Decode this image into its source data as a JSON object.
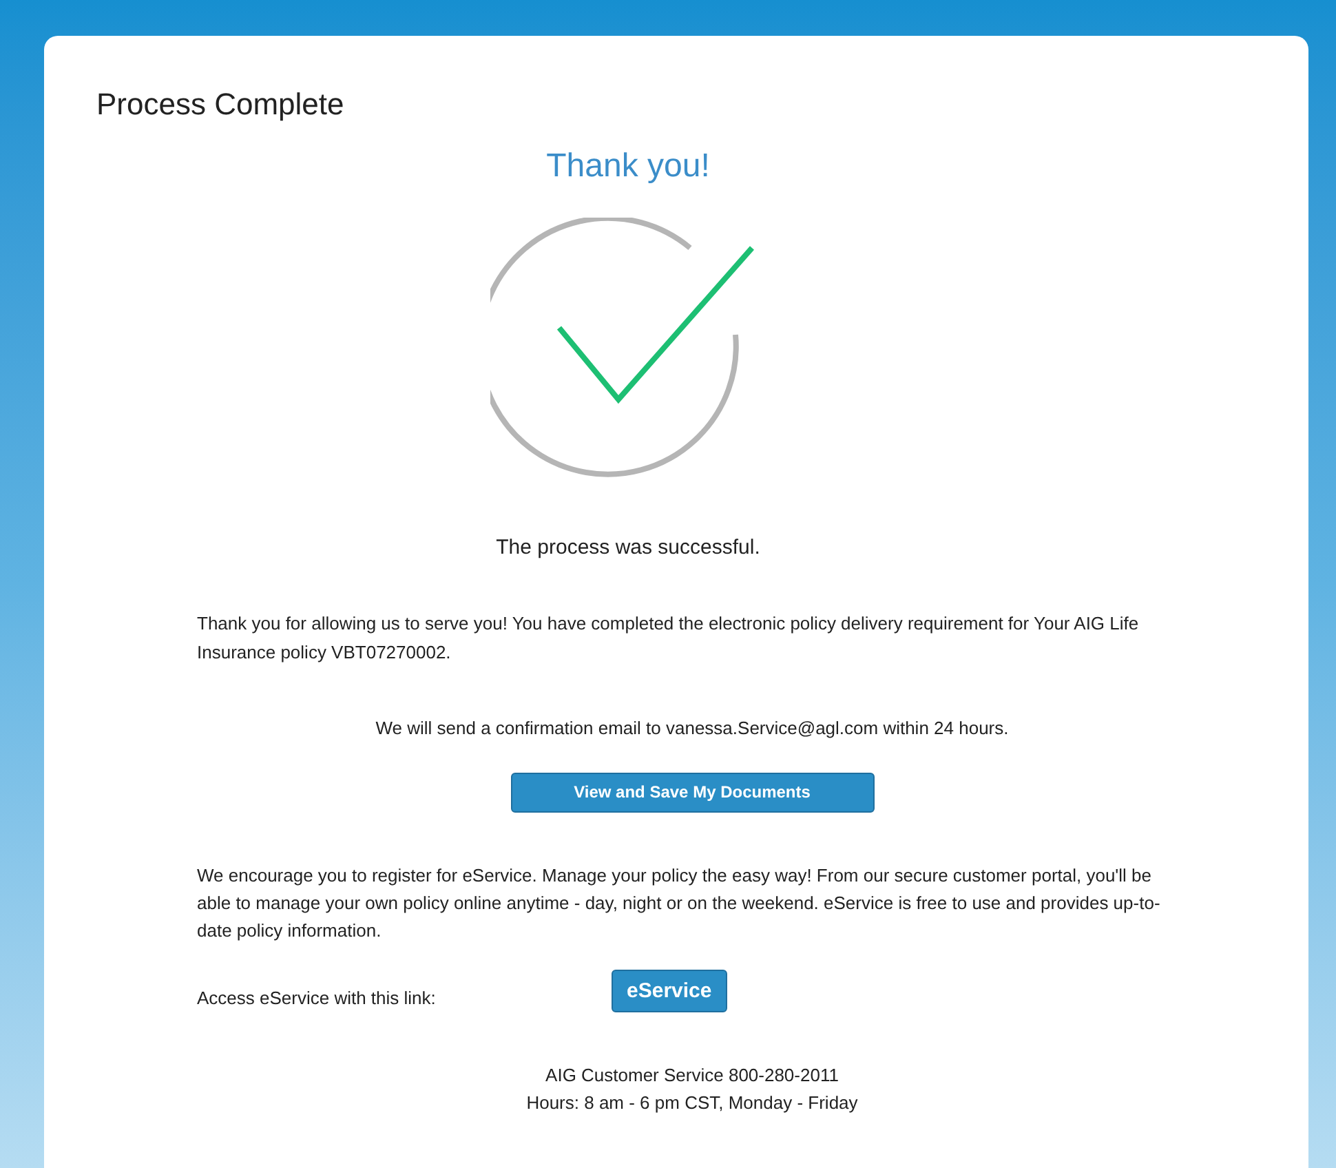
{
  "page_title": "Process Complete",
  "thank_you": "Thank you!",
  "status_message": "The process was successful.",
  "intro": "Thank you for allowing us to serve you! You have completed the electronic policy delivery requirement for Your AIG Life Insurance policy VBT07270002.",
  "email_notice": "We will send a confirmation email to vanessa.Service@agl.com within 24 hours.",
  "documents_button": "View and Save My Documents",
  "eservice_info": "We encourage you to register for eService. Manage your policy the easy way! From our secure customer portal, you'll be able to manage your own policy online anytime - day, night or on  the weekend.  eService is free to use and provides up-to-date policy information.",
  "access_label": "Access eService with this link:",
  "eservice_button": "eService",
  "footer": [
    "AIG Customer Service 800-280-2011",
    "Hours: 8 am - 6 pm CST, Monday - Friday"
  ]
}
